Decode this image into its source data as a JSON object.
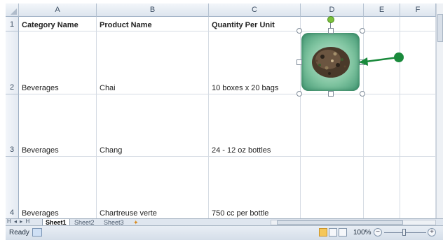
{
  "columns": [
    "A",
    "B",
    "C",
    "D",
    "E",
    "F"
  ],
  "rows": [
    {
      "num": "1",
      "cells": [
        "Category Name",
        "Product Name",
        "Quantity Per Unit",
        "",
        "",
        ""
      ]
    },
    {
      "num": "2",
      "cells": [
        "Beverages",
        "Chai",
        "10 boxes x 20 bags",
        "",
        "",
        ""
      ]
    },
    {
      "num": "3",
      "cells": [
        "Beverages",
        "Chang",
        "24 - 12 oz bottles",
        "",
        "",
        ""
      ]
    },
    {
      "num": "4",
      "cells": [
        "Beverages",
        "Chartreuse verte",
        "750 cc per bottle",
        "",
        "",
        ""
      ]
    }
  ],
  "sheet_tabs": {
    "nav": "H ◂ ▸ H",
    "tabs": [
      "Sheet1",
      "Sheet2",
      "Sheet3"
    ],
    "active": "Sheet1"
  },
  "status": {
    "ready": "Ready",
    "zoom": "100%",
    "zoom_minus": "−",
    "zoom_plus": "+"
  },
  "icons": {
    "picture": "tea-leaves-image",
    "annotation": "green-arrow-icon"
  },
  "colors": {
    "annotation_arrow": "#1a8a3c",
    "picture_glow": "#3f9470"
  }
}
